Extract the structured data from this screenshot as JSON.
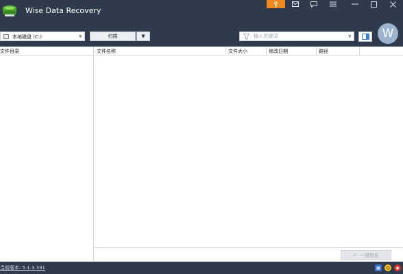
{
  "app": {
    "title": "Wise Data Recovery"
  },
  "toolbar": {
    "drive_label": "本地磁盘 (C:)",
    "scan_label": "扫描",
    "search_placeholder": "输入关键词",
    "avatar_letter": "W"
  },
  "left_panel": {
    "header": "文件目录"
  },
  "file_table": {
    "columns": [
      "文件名称",
      "文件大小",
      "修改日期",
      "路径"
    ]
  },
  "actions": {
    "recover_label": "一键恢复"
  },
  "status": {
    "version": "当前版本: 5.1.3.331"
  },
  "colors": {
    "titlebar": "#2f3a4c",
    "accent": "#ef8a1f"
  },
  "icons": {
    "logo": "wise-recovery-drive-logo",
    "window_buttons": [
      "key-icon",
      "mail-icon",
      "feedback-icon",
      "menu-icon",
      "minimize-icon",
      "maximize-icon",
      "close-icon"
    ],
    "status": [
      "network-icon",
      "smiley-icon",
      "weibo-icon"
    ]
  }
}
